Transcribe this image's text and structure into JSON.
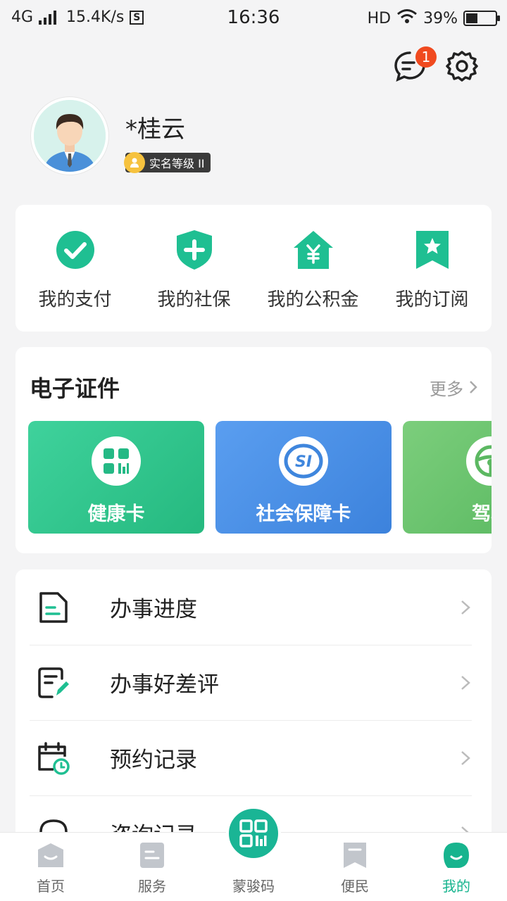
{
  "status_bar": {
    "network": "4G",
    "speed": "15.4K/s",
    "s_icon": "S",
    "time": "16:36",
    "hd": "HD",
    "battery": "39%",
    "battery_level": 0.39
  },
  "header": {
    "message_badge": "1"
  },
  "profile": {
    "name": "*桂云",
    "verify_label": "实名等级 II"
  },
  "quick_actions": [
    {
      "label": "我的支付",
      "icon": "check-circle-icon"
    },
    {
      "label": "我的社保",
      "icon": "shield-plus-icon"
    },
    {
      "label": "我的公积金",
      "icon": "house-yen-icon"
    },
    {
      "label": "我的订阅",
      "icon": "bookmark-star-icon"
    }
  ],
  "certificates": {
    "title": "电子证件",
    "more": "更多",
    "cards": [
      {
        "label": "健康卡",
        "icon": "health-code-icon"
      },
      {
        "label": "社会保障卡",
        "icon": "si-logo-icon"
      },
      {
        "label": "驾驶",
        "icon": "steering-wheel-icon"
      }
    ]
  },
  "menu": [
    {
      "label": "办事进度",
      "icon": "document-icon"
    },
    {
      "label": "办事好差评",
      "icon": "review-edit-icon"
    },
    {
      "label": "预约记录",
      "icon": "calendar-clock-icon"
    },
    {
      "label": "咨询记录",
      "icon": "headset-icon"
    }
  ],
  "bottom_nav": [
    {
      "label": "首页"
    },
    {
      "label": "服务"
    },
    {
      "label": "蒙骏码"
    },
    {
      "label": "便民"
    },
    {
      "label": "我的"
    }
  ],
  "colors": {
    "accent": "#1ab595",
    "badge": "#f04a1f",
    "health_card": "#2cc68b",
    "social_card": "#4a8fe6",
    "drive_card": "#66c16b"
  }
}
